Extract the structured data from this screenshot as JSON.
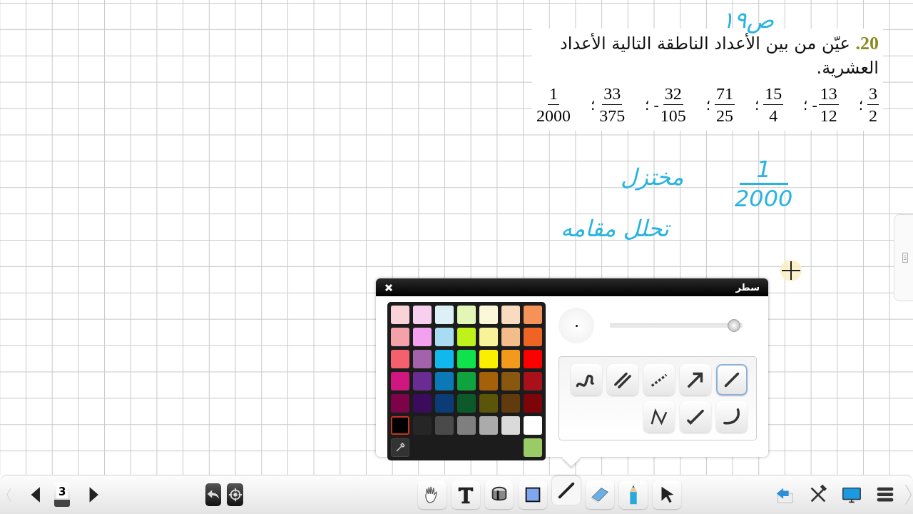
{
  "question": {
    "text": "**20.** عيّن من بين الأعداد الناطقة التالية الأعداد العشرية.",
    "fractions": [
      {
        "numerator": "3",
        "denominator": "2",
        "after": "؛"
      },
      {
        "sign": "-",
        "numerator": "13",
        "denominator": "12",
        "after": "؛"
      },
      {
        "numerator": "15",
        "denominator": "4",
        "after": "؛"
      },
      {
        "numerator": "71",
        "denominator": "25",
        "after": "؛"
      },
      {
        "sign": "-",
        "numerator": "32",
        "denominator": "105",
        "after": "؛"
      },
      {
        "numerator": "33",
        "denominator": "375",
        "after": "؛"
      },
      {
        "numerator": "1",
        "denominator": "2000"
      }
    ]
  },
  "annotations": [
    {
      "kind": "text",
      "text": "ص١٩"
    },
    {
      "kind": "text",
      "text": "مختزل"
    },
    {
      "kind": "fraction",
      "numerator": "1",
      "denominator": "2000"
    },
    {
      "kind": "text",
      "text": "تحلل مقامه"
    }
  ],
  "palette": {
    "title": "سطر",
    "colors": [
      {
        "color": "#f9d3d8",
        "selected": false
      },
      {
        "color": "#f6d0ee",
        "selected": false
      },
      {
        "color": "#ddf0f8",
        "selected": false
      },
      {
        "color": "#e3f6b8",
        "selected": false
      },
      {
        "color": "#fbf8d9",
        "selected": false
      },
      {
        "color": "#f9dcc0",
        "selected": false
      },
      {
        "color": "#f4925a",
        "selected": false
      },
      {
        "color": "#f5a1aa",
        "selected": false
      },
      {
        "color": "#f2a0ef",
        "selected": false
      },
      {
        "color": "#a9dcf2",
        "selected": false
      },
      {
        "color": "#bef21a",
        "selected": false
      },
      {
        "color": "#f8f299",
        "selected": false
      },
      {
        "color": "#f2bd8b",
        "selected": false
      },
      {
        "color": "#ef6424",
        "selected": false
      },
      {
        "color": "#f5606e",
        "selected": false
      },
      {
        "color": "#a363aa",
        "selected": false
      },
      {
        "color": "#10b8ee",
        "selected": false
      },
      {
        "color": "#0fe24a",
        "selected": false
      },
      {
        "color": "#fbef00",
        "selected": false
      },
      {
        "color": "#f39a1c",
        "selected": false
      },
      {
        "color": "#fc0000",
        "selected": false
      },
      {
        "color": "#d0167f",
        "selected": false
      },
      {
        "color": "#6a2c93",
        "selected": false
      },
      {
        "color": "#0a79b6",
        "selected": false
      },
      {
        "color": "#0ea33e",
        "selected": false
      },
      {
        "color": "#a5600a",
        "selected": false
      },
      {
        "color": "#885810",
        "selected": false
      },
      {
        "color": "#a8111a",
        "selected": false
      },
      {
        "color": "#7d0348",
        "selected": false
      },
      {
        "color": "#3b0b5c",
        "selected": false
      },
      {
        "color": "#0c3c78",
        "selected": false
      },
      {
        "color": "#0c5a2a",
        "selected": false
      },
      {
        "color": "#5a5508",
        "selected": false
      },
      {
        "color": "#613a0e",
        "selected": false
      },
      {
        "color": "#7d0408",
        "selected": false
      },
      {
        "color": "#000000",
        "selected": true
      },
      {
        "color": "#262626",
        "selected": false
      },
      {
        "color": "#4a4a4a",
        "selected": false
      },
      {
        "color": "#7f7f7f",
        "selected": false
      },
      {
        "color": "#ababab",
        "selected": false
      },
      {
        "color": "#dadada",
        "selected": false
      },
      {
        "color": "#ffffff",
        "selected": false
      }
    ],
    "custom_swatch": {
      "color": "#99cc66"
    },
    "thickness": {
      "level": 0.93
    },
    "line_styles": [
      {
        "kind": "freehand",
        "selected": false
      },
      {
        "kind": "double",
        "selected": false
      },
      {
        "kind": "dotted",
        "selected": false
      },
      {
        "kind": "arrow",
        "selected": false
      },
      {
        "kind": "straight",
        "selected": true
      },
      {
        "kind": "polyline",
        "selected": false
      },
      {
        "kind": "tick",
        "selected": false
      },
      {
        "kind": "arc",
        "selected": false
      }
    ]
  },
  "toolbar": {
    "page": "3",
    "tools": [
      {
        "kind": "hand",
        "selected": false
      },
      {
        "kind": "text",
        "selected": false
      },
      {
        "kind": "fill",
        "selected": false
      },
      {
        "kind": "shape",
        "selected": false
      },
      {
        "kind": "line",
        "selected": true
      },
      {
        "kind": "eraser",
        "selected": false
      },
      {
        "kind": "pencil",
        "selected": false
      },
      {
        "kind": "pointer",
        "selected": false
      }
    ]
  }
}
